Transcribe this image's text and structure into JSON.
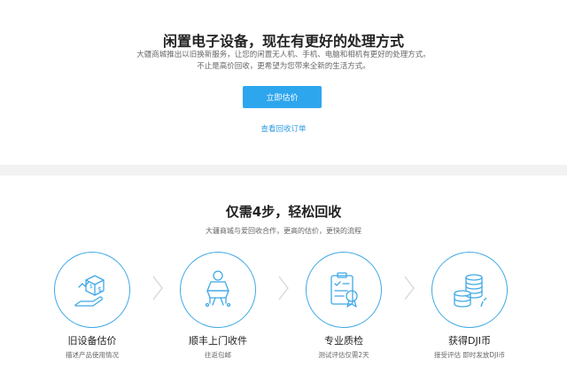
{
  "hero": {
    "title": "闲置电子设备，现在有更好的处理方式",
    "desc_line1": "大疆商城推出以旧换新服务，让您的闲置无人机、手机、电脑和相机有更好的处理方式。",
    "desc_line2": "不止是高价回收，更希望为您带来全新的生活方式。",
    "estimate_button": "立即估价",
    "orders_link": "查看回收订单"
  },
  "steps_section": {
    "title": "仅需4步，轻松回收",
    "subtitle": "大疆商城与爱回收合作，更高的估价，更快的流程",
    "steps": [
      {
        "title": "旧设备估价",
        "desc": "描述产品使用情况",
        "icon": "device-valuation-icon"
      },
      {
        "title": "顺丰上门收件",
        "desc": "往返包邮",
        "icon": "courier-pickup-icon"
      },
      {
        "title": "专业质检",
        "desc": "测试评估仅需2天",
        "icon": "quality-inspection-icon"
      },
      {
        "title": "获得DJI币",
        "desc": "接受评估 即时发放DJI币",
        "icon": "dji-coins-icon"
      }
    ]
  },
  "colors": {
    "accent": "#2da6ee",
    "link": "#2d9be3",
    "icon_line": "#3fa8e5",
    "background": "#f2f2f2"
  }
}
